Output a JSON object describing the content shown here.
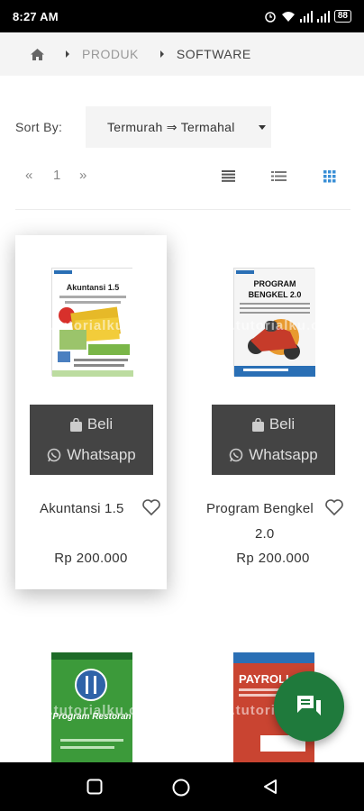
{
  "status_bar": {
    "time": "8:27 AM",
    "battery": "88",
    "icons": [
      "alarm-icon",
      "wifi-icon",
      "signal-icon",
      "signal-icon",
      "battery-icon"
    ]
  },
  "breadcrumb": {
    "home_icon": "home-icon",
    "items": [
      "PRODUK",
      "SOFTWARE"
    ]
  },
  "sort": {
    "label": "Sort By:",
    "selected": "Termurah ⇒ Termahal"
  },
  "pagination": {
    "prev": "«",
    "current": "1",
    "next": "»"
  },
  "view_modes": [
    "list-view-icon",
    "compact-list-icon",
    "grid-view-icon"
  ],
  "products": [
    {
      "name": "Akuntansi 1.5",
      "price": "Rp 200.000",
      "buy_label": "Beli",
      "whatsapp_label": "Whatsapp",
      "cover_title": "Akuntansi 1.5",
      "cover_subtitle": "Program Keuangan Untuk UKM",
      "watermark": "www.tutorialku.com"
    },
    {
      "name_line1": "Program Bengkel",
      "name_line2": "2.0",
      "price": "Rp 200.000",
      "buy_label": "Beli",
      "whatsapp_label": "Whatsapp",
      "cover_title": "PROGRAM BENGKEL 2.0",
      "watermark": "www.tutorialku.com"
    },
    {
      "cover_title": "Program Restoran",
      "watermark": "www.tutorialku.com"
    },
    {
      "cover_title": "PAYROLL",
      "watermark": "www.tutorialku.com"
    }
  ],
  "colors": {
    "accent_grid": "#3a8fd6",
    "buy_block": "#444444",
    "fab": "#1f7a3c"
  },
  "chat_fab_icon": "chat-icon",
  "nav_icons": [
    "recent-apps-icon",
    "home-circle-icon",
    "back-icon"
  ]
}
